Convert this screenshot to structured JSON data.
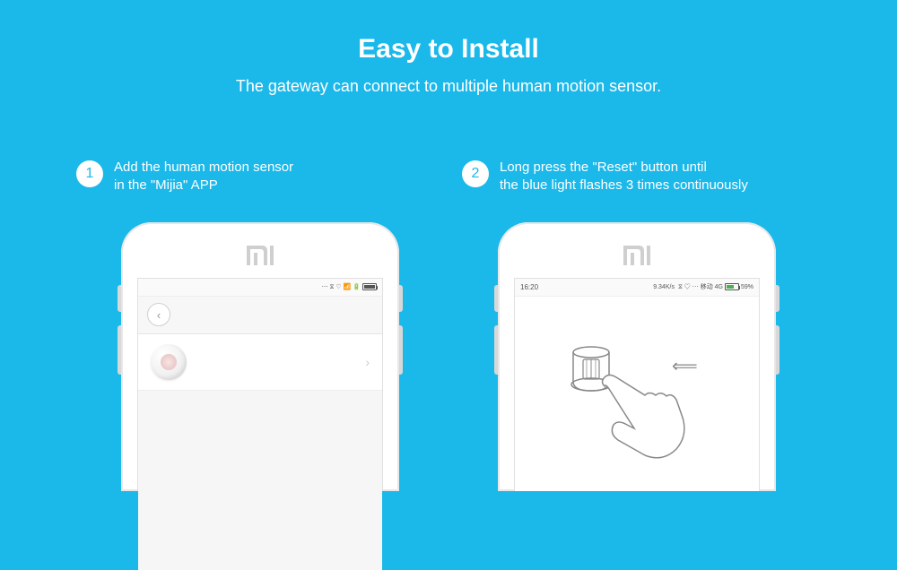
{
  "title": "Easy to Install",
  "subtitle": "The gateway can connect to multiple human motion sensor.",
  "steps": [
    {
      "number": "1",
      "text": "Add the human motion sensor\n in the \"Mijia\" APP"
    },
    {
      "number": "2",
      "text": "Long press the \"Reset\" button until\nthe blue light flashes 3 times continuously"
    }
  ],
  "phone1": {
    "status_icons": "⋯ ⧖ ♡ 📶 🔋"
  },
  "phone2": {
    "time": "16:20",
    "network": "9.34K/s",
    "status": "⧖ ♡ ⋯ 移动 4G",
    "battery": "59%"
  },
  "arrow": "⟸"
}
